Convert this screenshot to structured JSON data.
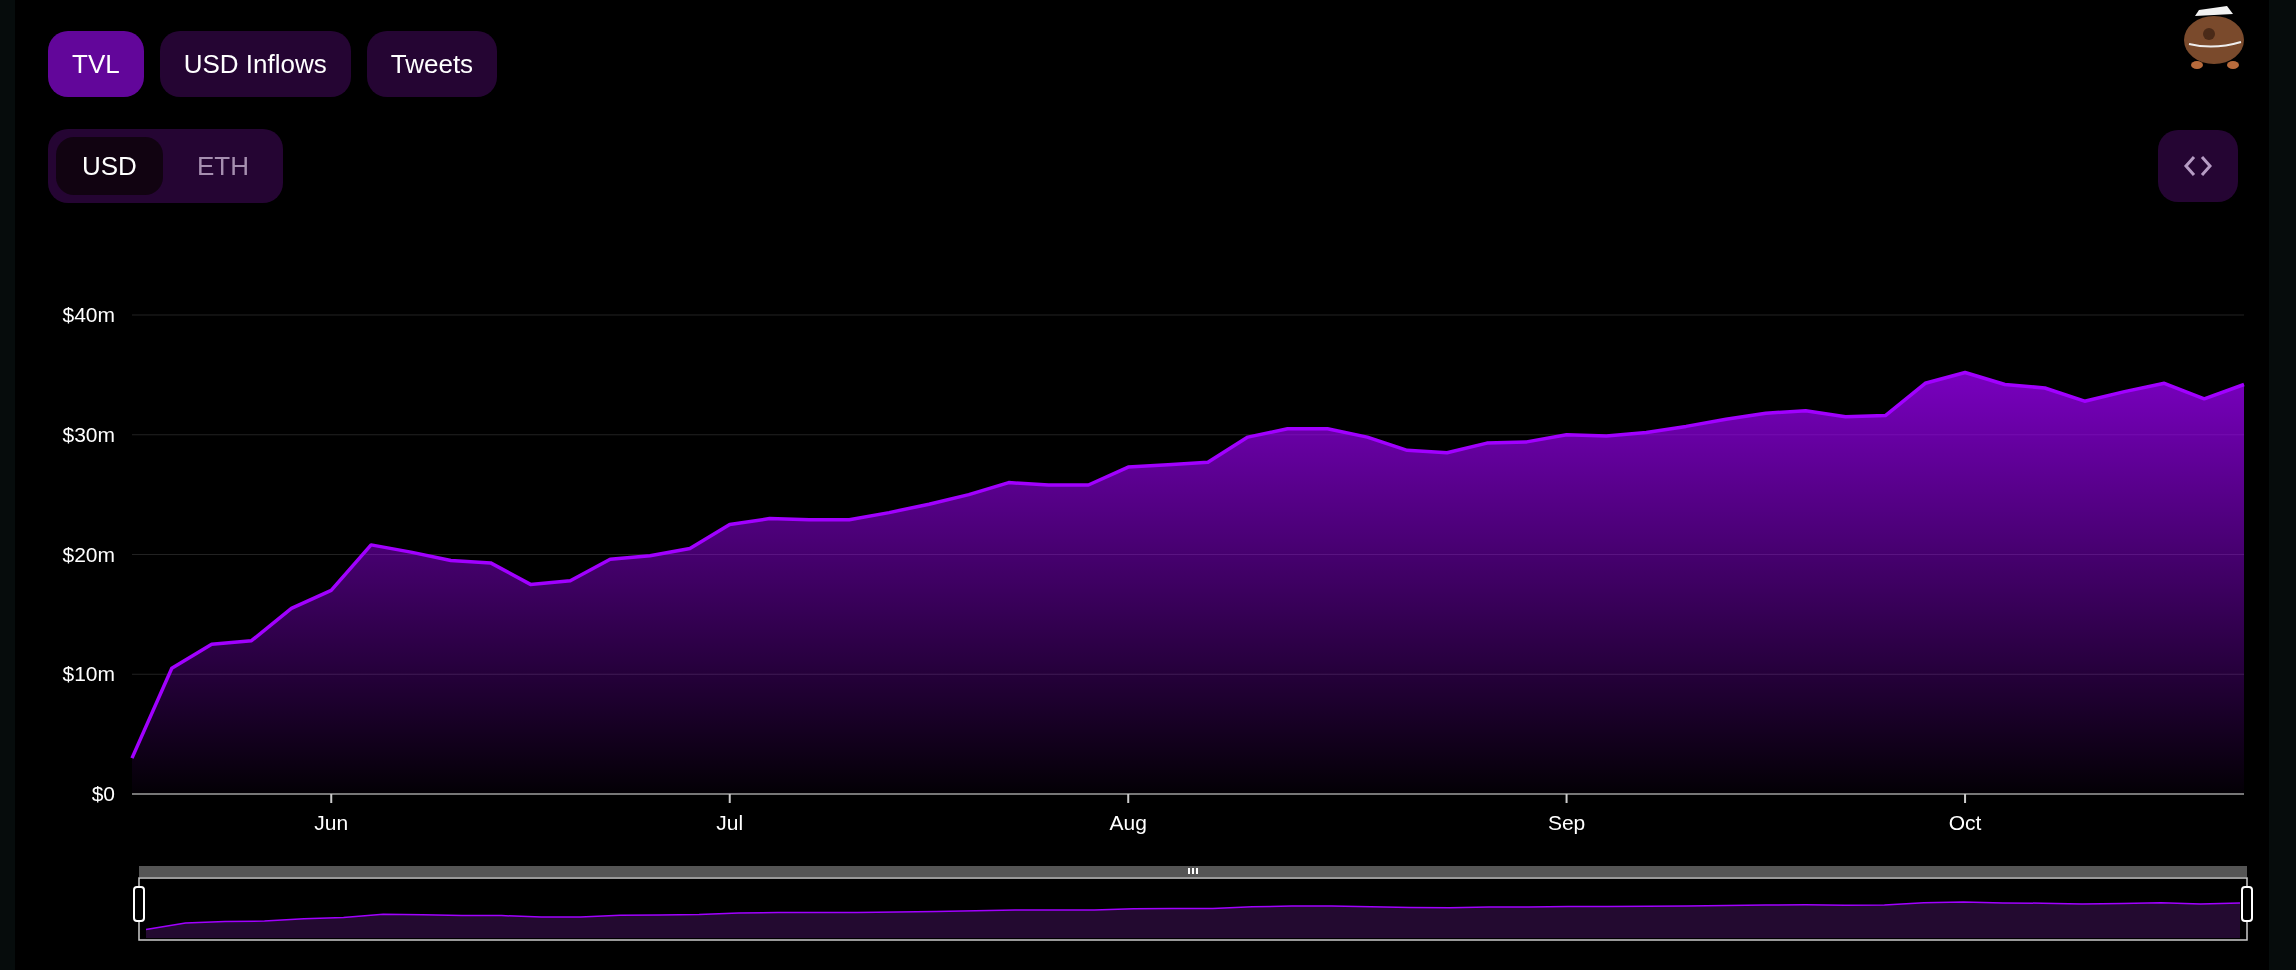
{
  "tabs": [
    {
      "label": "TVL",
      "selected": true
    },
    {
      "label": "USD Inflows",
      "selected": false
    },
    {
      "label": "Tweets",
      "selected": false
    }
  ],
  "currency_toggle": [
    {
      "label": "USD",
      "selected": true
    },
    {
      "label": "ETH",
      "selected": false
    }
  ],
  "chart_data": {
    "type": "area",
    "categories": [
      null,
      null,
      null,
      null,
      null,
      "Jun",
      null,
      null,
      null,
      null,
      null,
      null,
      null,
      null,
      null,
      "Jul",
      null,
      null,
      null,
      null,
      null,
      null,
      null,
      null,
      null,
      "Aug",
      null,
      null,
      null,
      null,
      null,
      null,
      null,
      null,
      null,
      null,
      "Sep",
      null,
      null,
      null,
      null,
      null,
      null,
      null,
      null,
      null,
      "Oct",
      null,
      null,
      null,
      null,
      null,
      null,
      null
    ],
    "series": [
      {
        "color": "#a100ff",
        "values": [
          3,
          10.5,
          12.5,
          12.8,
          15.5,
          17,
          20.8,
          20.2,
          19.5,
          19.3,
          17.5,
          17.8,
          19.6,
          19.9,
          20.5,
          22.5,
          23,
          22.9,
          22.9,
          23.5,
          24.2,
          25,
          26,
          25.8,
          25.8,
          27.3,
          27.5,
          27.7,
          29.8,
          30.5,
          30.5,
          29.8,
          28.7,
          28.5,
          29.3,
          29.4,
          30,
          29.9,
          30.2,
          30.7,
          31.3,
          31.8,
          32,
          31.5,
          31.6,
          34.3,
          35.2,
          34.2,
          33.9,
          32.8,
          33.6,
          34.3,
          33,
          34.2
        ]
      }
    ],
    "ylim": [
      0,
      40
    ],
    "grid": true,
    "yticks": [
      {
        "value": 0,
        "label": "$0"
      },
      {
        "value": 10,
        "label": "$10m"
      },
      {
        "value": 20,
        "label": "$20m"
      },
      {
        "value": 30,
        "label": "$30m"
      },
      {
        "value": 40,
        "label": "$40m"
      }
    ]
  }
}
